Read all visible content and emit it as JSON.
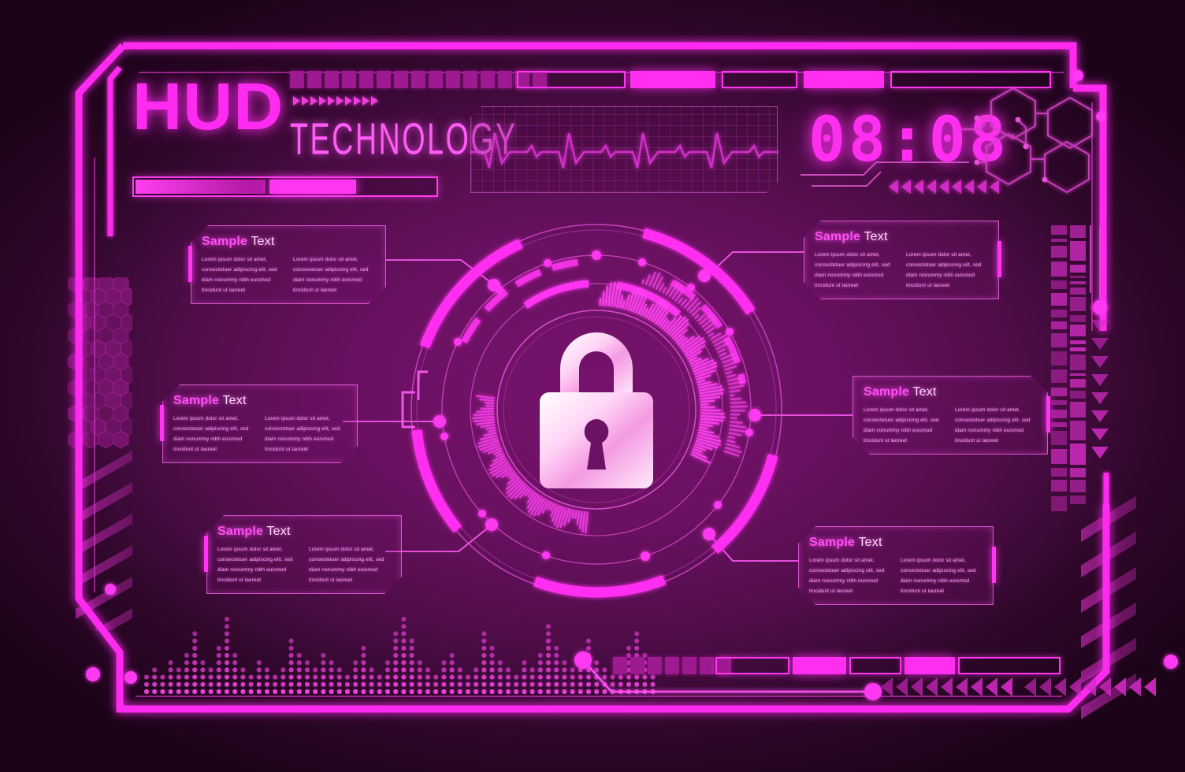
{
  "meta": {
    "title_main": "HUD",
    "title_sub": "TECHNOLOGY",
    "clock": "08:08"
  },
  "colors": {
    "accent": "#ff2bf0",
    "accent_soft": "#ff5cf5",
    "background_dark": "#1b0318",
    "background_center": "#76126c",
    "text_body": "#f9a7f2",
    "heading_light": "#ffd9fb"
  },
  "center": {
    "icon": "padlock-icon",
    "label": "security-lock"
  },
  "cards": [
    {
      "id": "card-top-left",
      "heading_bold": "Sample",
      "heading_light": "Text",
      "col1": "Lorem ipsum dolor sit amet, consectetuer adipiscing elit, sed diam nonummy nibh euismod tincidunt ut laoreet",
      "col2": "Lorem ipsum dolor sit amet, consectetuer adipiscing elit, sed diam nonummy nibh euismod tincidunt ut laoreet"
    },
    {
      "id": "card-mid-left",
      "heading_bold": "Sample",
      "heading_light": "Text",
      "col1": "Lorem ipsum dolor sit amet, consectetuer adipiscing elit, sed diam nonummy nibh euismod tincidunt ut laoreet",
      "col2": "Lorem ipsum dolor sit amet, consectetuer adipiscing elit, sed diam nonummy nibh euismod tincidunt ut laoreet"
    },
    {
      "id": "card-bottom-left",
      "heading_bold": "Sample",
      "heading_light": "Text",
      "col1": "Lorem ipsum dolor sit amet, consectetuer adipiscing elit, sed diam nonummy nibh euismod tincidunt ut laoreet",
      "col2": "Lorem ipsum dolor sit amet, consectetuer adipiscing elit, sed diam nonummy nibh euismod tincidunt ut laoreet"
    },
    {
      "id": "card-top-right",
      "heading_bold": "Sample",
      "heading_light": "Text",
      "col1": "Lorem ipsum dolor sit amet, consectetuer adipiscing elit, sed diam nonummy nibh euismod tincidunt ut laoreet",
      "col2": "Lorem ipsum dolor sit amet, consectetuer adipiscing elit, sed diam nonummy nibh euismod tincidunt ut laoreet"
    },
    {
      "id": "card-mid-right",
      "heading_bold": "Sample",
      "heading_light": "Text",
      "col1": "Lorem ipsum dolor sit amet, consectetuer adipiscing elit, sed diam nonummy nibh euismod tincidunt ut laoreet",
      "col2": "Lorem ipsum dolor sit amet, consectetuer adipiscing elit, sed diam nonummy nibh euismod tincidunt ut laoreet"
    },
    {
      "id": "card-bottom-right",
      "heading_bold": "Sample",
      "heading_light": "Text",
      "col1": "Lorem ipsum dolor sit amet, consectetuer adipiscing elit, sed diam nonummy nibh euismod tincidunt ut laoreet",
      "col2": "Lorem ipsum dolor sit amet, consectetuer adipiscing elit, sed diam nonummy nibh euismod tincidunt ut laoreet"
    }
  ],
  "widgets": {
    "progress_bar": {
      "name": "loading-progress-bar",
      "segments": 2
    },
    "ekg": {
      "name": "heartbeat-waveform-panel",
      "beats": 6
    },
    "arrows_title": {
      "name": "chevron-right-arrows",
      "count": 10
    },
    "arrows_clock": {
      "name": "chevron-left-arrows",
      "count": 9
    },
    "arrows_bottom_a": {
      "name": "chevron-left-arrows",
      "count": 9
    },
    "arrows_bottom_b": {
      "name": "chevron-left-arrows",
      "count": 9
    },
    "arrows_right_down": {
      "name": "chevron-down-arrows",
      "count": 8
    },
    "top_squares": {
      "name": "status-square-row",
      "count": 15
    },
    "bottom_squares": {
      "name": "status-square-row",
      "count": 7
    },
    "equalizer": {
      "name": "dot-matrix-equalizer",
      "bars": 64
    },
    "hex_circuit": {
      "name": "hexagon-circuit-cluster",
      "count": 4
    },
    "honeycomb": {
      "name": "honeycomb-pattern"
    },
    "data_bars_right": {
      "name": "vertical-data-bar-columns",
      "columns": 2
    }
  }
}
